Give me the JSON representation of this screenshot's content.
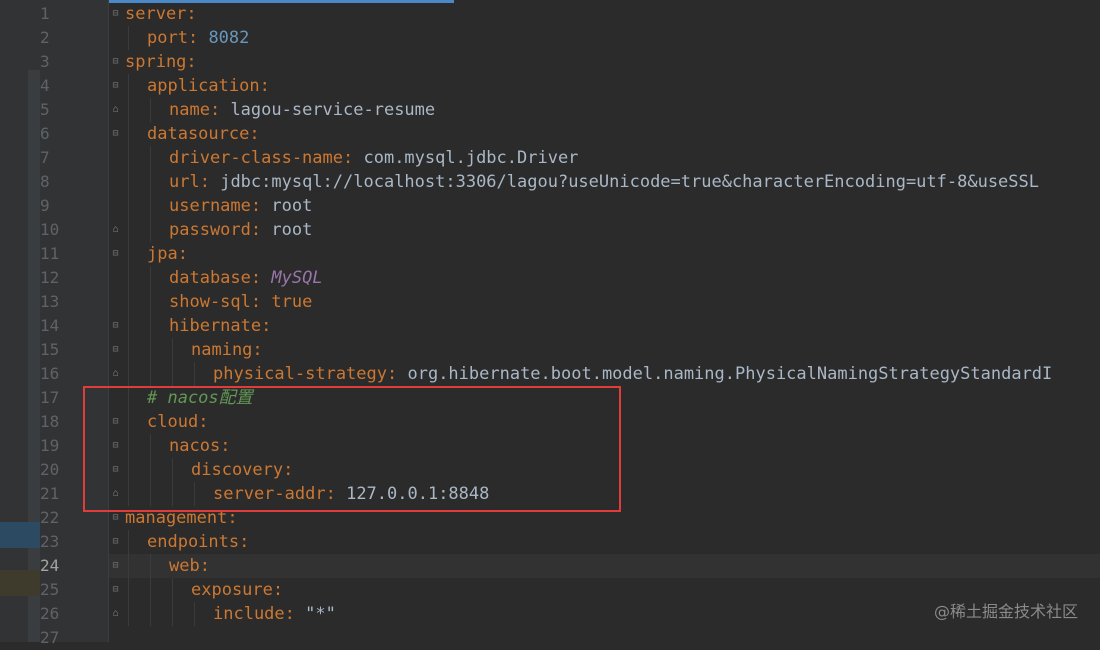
{
  "editor": {
    "language": "yaml",
    "current_line": 24,
    "lines": [
      {
        "num": "1",
        "indent": 0,
        "key": "server",
        "sep": ":",
        "value": "",
        "vtype": "plain"
      },
      {
        "num": "2",
        "indent": 1,
        "key": "port",
        "sep": ": ",
        "value": "8082",
        "vtype": "number"
      },
      {
        "num": "3",
        "indent": 0,
        "key": "spring",
        "sep": ":",
        "value": "",
        "vtype": "plain"
      },
      {
        "num": "4",
        "indent": 1,
        "key": "application",
        "sep": ":",
        "value": "",
        "vtype": "plain"
      },
      {
        "num": "5",
        "indent": 2,
        "key": "name",
        "sep": ": ",
        "value": "lagou-service-resume",
        "vtype": "plain"
      },
      {
        "num": "6",
        "indent": 1,
        "key": "datasource",
        "sep": ":",
        "value": "",
        "vtype": "plain"
      },
      {
        "num": "7",
        "indent": 2,
        "key": "driver-class-name",
        "sep": ": ",
        "value": "com.mysql.jdbc.Driver",
        "vtype": "plain"
      },
      {
        "num": "8",
        "indent": 2,
        "key": "url",
        "sep": ": ",
        "value": "jdbc:mysql://localhost:3306/lagou?useUnicode=true&characterEncoding=utf-8&useSSL",
        "vtype": "plain"
      },
      {
        "num": "9",
        "indent": 2,
        "key": "username",
        "sep": ": ",
        "value": "root",
        "vtype": "plain"
      },
      {
        "num": "10",
        "indent": 2,
        "key": "password",
        "sep": ": ",
        "value": "root",
        "vtype": "plain"
      },
      {
        "num": "11",
        "indent": 1,
        "key": "jpa",
        "sep": ":",
        "value": "",
        "vtype": "plain"
      },
      {
        "num": "12",
        "indent": 2,
        "key": "database",
        "sep": ": ",
        "value": "MySQL",
        "vtype": "italic"
      },
      {
        "num": "13",
        "indent": 2,
        "key": "show-sql",
        "sep": ": ",
        "value": "true",
        "vtype": "keyword"
      },
      {
        "num": "14",
        "indent": 2,
        "key": "hibernate",
        "sep": ":",
        "value": "",
        "vtype": "plain"
      },
      {
        "num": "15",
        "indent": 3,
        "key": "naming",
        "sep": ":",
        "value": "",
        "vtype": "plain"
      },
      {
        "num": "16",
        "indent": 4,
        "key": "physical-strategy",
        "sep": ": ",
        "value": "org.hibernate.boot.model.naming.PhysicalNamingStrategyStandardI",
        "vtype": "plain"
      },
      {
        "num": "17",
        "indent": 1,
        "comment": "# nacos配置"
      },
      {
        "num": "18",
        "indent": 1,
        "key": "cloud",
        "sep": ":",
        "value": "",
        "vtype": "plain"
      },
      {
        "num": "19",
        "indent": 2,
        "key": "nacos",
        "sep": ":",
        "value": "",
        "vtype": "plain"
      },
      {
        "num": "20",
        "indent": 3,
        "key": "discovery",
        "sep": ":",
        "value": "",
        "vtype": "plain"
      },
      {
        "num": "21",
        "indent": 4,
        "key": "server-addr",
        "sep": ": ",
        "value": "127.0.0.1:8848",
        "vtype": "plain"
      },
      {
        "num": "22",
        "indent": 0,
        "key": "management",
        "sep": ":",
        "value": "",
        "vtype": "plain"
      },
      {
        "num": "23",
        "indent": 1,
        "key": "endpoints",
        "sep": ":",
        "value": "",
        "vtype": "plain"
      },
      {
        "num": "24",
        "indent": 2,
        "key": "web",
        "sep": ":",
        "value": "",
        "vtype": "plain"
      },
      {
        "num": "25",
        "indent": 3,
        "key": "exposure",
        "sep": ":",
        "value": "",
        "vtype": "plain"
      },
      {
        "num": "26",
        "indent": 4,
        "key": "include",
        "sep": ": ",
        "value": "\"*\"",
        "vtype": "plain"
      },
      {
        "num": "27",
        "indent": 0,
        "key": "",
        "sep": "",
        "value": "",
        "vtype": "plain"
      }
    ]
  },
  "annotation": {
    "box_color": "#e03c3c"
  },
  "watermark": "@稀土掘金技术社区",
  "colors": {
    "background": "#2b2b2b",
    "key": "#cc7832",
    "value": "#a9b7c6",
    "number": "#6897bb",
    "comment": "#629755",
    "italic_value": "#9876aa"
  }
}
